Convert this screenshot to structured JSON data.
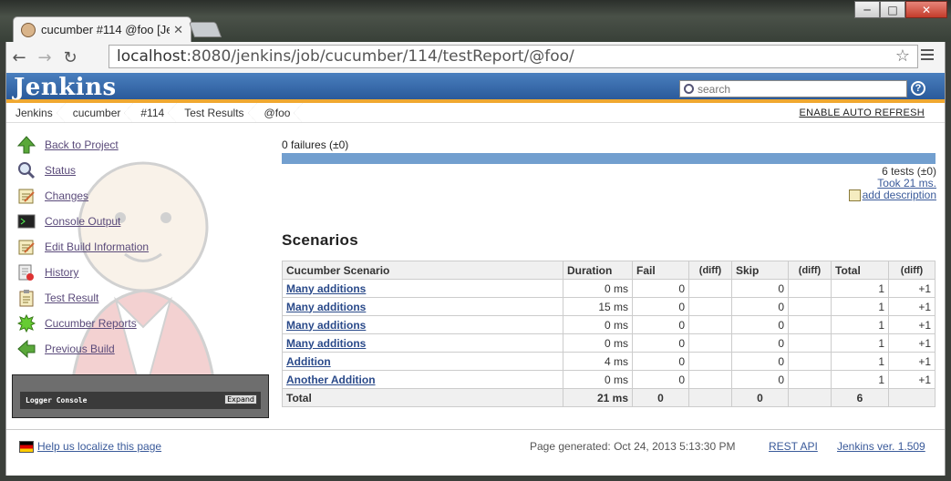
{
  "browser": {
    "tab_title": "cucumber #114 @foo [Jen",
    "url_host": "localhost",
    "url_path": ":8080/jenkins/job/cucumber/114/testReport/@foo/",
    "window_buttons": [
      "─",
      "□",
      "✕"
    ]
  },
  "header": {
    "logo": "Jenkins",
    "search_placeholder": "search",
    "help_label": "?"
  },
  "breadcrumbs": [
    "Jenkins",
    "cucumber",
    "#114",
    "Test Results",
    "@foo"
  ],
  "auto_refresh": "ENABLE AUTO REFRESH",
  "sidebar": {
    "items": [
      {
        "label": "Back to Project",
        "icon": "up-arrow-icon"
      },
      {
        "label": "Status",
        "icon": "magnifier-icon"
      },
      {
        "label": "Changes",
        "icon": "notepad-icon"
      },
      {
        "label": "Console Output",
        "icon": "terminal-icon"
      },
      {
        "label": "Edit Build Information",
        "icon": "notepad-icon"
      },
      {
        "label": "History",
        "icon": "history-icon"
      },
      {
        "label": "Test Result",
        "icon": "clipboard-icon"
      },
      {
        "label": "Cucumber Reports",
        "icon": "cucumber-icon"
      },
      {
        "label": "Previous Build",
        "icon": "left-arrow-icon"
      }
    ],
    "logger_title": "Logger Console",
    "logger_expand": "Expand"
  },
  "summary": {
    "failures": "0 failures (±0)",
    "tests": "6 tests (±0)",
    "took": "Took 21 ms.",
    "add_description": "add description",
    "pass_fraction": 1.0
  },
  "section_title": "Scenarios",
  "table": {
    "headers": [
      "Cucumber Scenario",
      "Duration",
      "Fail",
      "(diff)",
      "Skip",
      "(diff)",
      "Total",
      "(diff)"
    ],
    "rows": [
      {
        "name": "Many additions",
        "duration": "0 ms",
        "fail": "0",
        "fail_diff": "",
        "skip": "0",
        "skip_diff": "",
        "total": "1",
        "total_diff": "+1"
      },
      {
        "name": "Many additions",
        "duration": "15 ms",
        "fail": "0",
        "fail_diff": "",
        "skip": "0",
        "skip_diff": "",
        "total": "1",
        "total_diff": "+1"
      },
      {
        "name": "Many additions",
        "duration": "0 ms",
        "fail": "0",
        "fail_diff": "",
        "skip": "0",
        "skip_diff": "",
        "total": "1",
        "total_diff": "+1"
      },
      {
        "name": "Many additions",
        "duration": "0 ms",
        "fail": "0",
        "fail_diff": "",
        "skip": "0",
        "skip_diff": "",
        "total": "1",
        "total_diff": "+1"
      },
      {
        "name": "Addition",
        "duration": "4 ms",
        "fail": "0",
        "fail_diff": "",
        "skip": "0",
        "skip_diff": "",
        "total": "1",
        "total_diff": "+1"
      },
      {
        "name": "Another Addition",
        "duration": "0 ms",
        "fail": "0",
        "fail_diff": "",
        "skip": "0",
        "skip_diff": "",
        "total": "1",
        "total_diff": "+1"
      }
    ],
    "total_row": {
      "label": "Total",
      "duration": "21 ms",
      "fail": "0",
      "skip": "0",
      "total": "6"
    }
  },
  "footer": {
    "localize": "Help us localize this page",
    "generated": "Page generated: Oct 24, 2013 5:13:30 PM",
    "rest_api": "REST API",
    "version": "Jenkins ver. 1.509"
  },
  "colors": {
    "header_blue": "#3a6aa8",
    "header_stripe": "#f0a830",
    "progress_blue": "#729fcf"
  }
}
